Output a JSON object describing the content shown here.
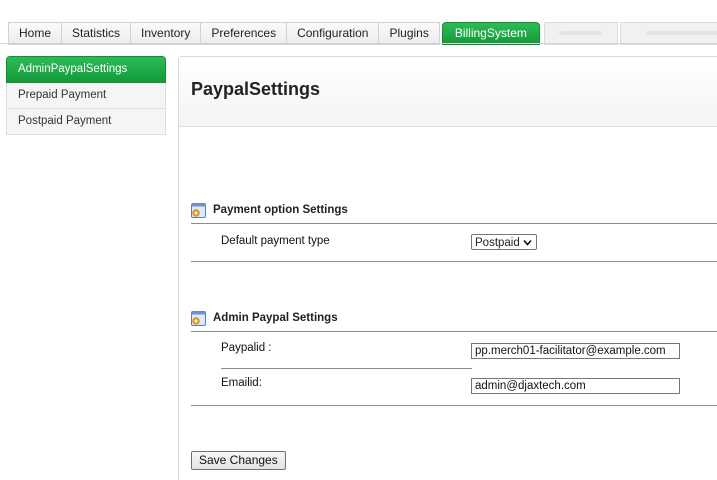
{
  "tabs": [
    {
      "label": "Home"
    },
    {
      "label": "Statistics"
    },
    {
      "label": "Inventory"
    },
    {
      "label": "Preferences"
    },
    {
      "label": "Configuration"
    },
    {
      "label": "Plugins"
    },
    {
      "label": "BillingSystem",
      "active": true
    }
  ],
  "sidebar": {
    "items": [
      {
        "label": "AdminPaypalSettings",
        "active": true
      },
      {
        "label": "Prepaid Payment"
      },
      {
        "label": "Postpaid Payment"
      }
    ]
  },
  "main": {
    "title": "PaypalSettings",
    "payment_section": {
      "title": "Payment option Settings",
      "default_type_label": "Default payment type",
      "default_type_value": "Postpaid"
    },
    "paypal_section": {
      "title": "Admin Paypal Settings",
      "paypalid_label": "Paypalid :",
      "paypalid_value": "pp.merch01-facilitator@example.com",
      "emailid_label": "Emailid:",
      "emailid_value": "admin@djaxtech.com"
    },
    "save_label": "Save Changes"
  },
  "colors": {
    "accent_green": "#1aa347",
    "border": "#d8d8d8"
  }
}
